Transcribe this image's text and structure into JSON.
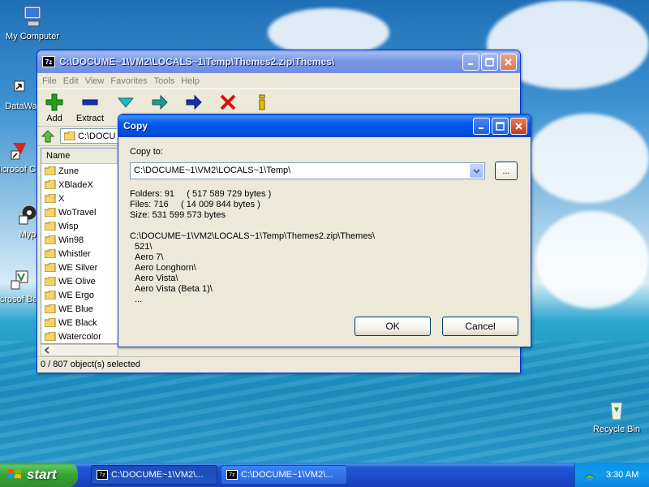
{
  "desktop": {
    "icons": [
      {
        "label": "My Computer"
      },
      {
        "label": "DataWa"
      },
      {
        "label": "Microsof C++"
      },
      {
        "label": "Myp"
      },
      {
        "label": "Microsof Basic"
      },
      {
        "label": "Recycle Bin"
      }
    ]
  },
  "main_window": {
    "title": "C:\\DOCUME~1\\VM2\\LOCALS~1\\Temp\\Themes2.zip\\Themes\\",
    "app_icon_text": "7z",
    "menu": [
      "File",
      "Edit",
      "View",
      "Favorites",
      "Tools",
      "Help"
    ],
    "toolbar": [
      {
        "label": "Add",
        "icon": "plus-icon"
      },
      {
        "label": "Extract",
        "icon": "minus-icon"
      },
      {
        "label": "",
        "icon": "test-check-icon"
      },
      {
        "label": "",
        "icon": "copy-arrow-icon"
      },
      {
        "label": "",
        "icon": "move-arrow-icon"
      },
      {
        "label": "",
        "icon": "delete-x-icon"
      },
      {
        "label": "",
        "icon": "info-icon"
      }
    ],
    "address": "C:\\DOCU",
    "list_header": "Name",
    "folders": [
      "Zune",
      "XBladeX",
      "X",
      "WoTravel",
      "Wisp",
      "Win98",
      "Whistler",
      "WE Silver",
      "WE Olive",
      "WE Ergo",
      "WE Blue",
      "WE Black",
      "Watercolor"
    ],
    "status": "0 / 807 object(s) selected"
  },
  "copy_dialog": {
    "title": "Copy",
    "copy_to_label": "Copy to:",
    "destination": "C:\\DOCUME~1\\VM2\\LOCALS~1\\Temp\\",
    "browse_label": "...",
    "stats": {
      "folders": "Folders: 91     ( 517 589 729 bytes )",
      "files": "Files: 716     ( 14 009 844 bytes )",
      "size": "Size: 531 599 573 bytes"
    },
    "source_path": "C:\\DOCUME~1\\VM2\\LOCALS~1\\Temp\\Themes2.zip\\Themes\\",
    "items": [
      "521\\",
      "Aero 7\\",
      "Aero Longhorn\\",
      "Aero Vista\\",
      "Aero Vista (Beta 1)\\",
      "..."
    ],
    "ok_label": "OK",
    "cancel_label": "Cancel"
  },
  "taskbar": {
    "start_label": "start",
    "tasks": [
      {
        "label": "C:\\DOCUME~1\\VM2\\..."
      },
      {
        "label": "C:\\DOCUME~1\\VM2\\..."
      }
    ],
    "clock": "3:30 AM"
  }
}
